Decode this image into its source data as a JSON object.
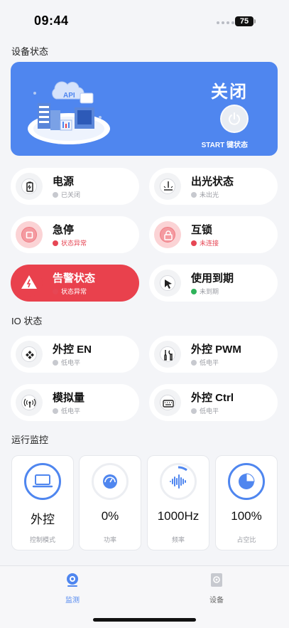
{
  "status_bar": {
    "time": "09:44",
    "battery": "75"
  },
  "sections": {
    "device": "设备状态",
    "io": "IO 状态",
    "monitor": "运行监控"
  },
  "hero": {
    "illustration_label": "API",
    "state": "关闭",
    "subtitle": "START 键状态"
  },
  "device_status": [
    {
      "title": "电源",
      "status": "已关闭",
      "kind": "info",
      "icon": "battery-icon"
    },
    {
      "title": "出光状态",
      "status": "未出光",
      "kind": "info",
      "icon": "laser-icon"
    },
    {
      "title": "急停",
      "status": "状态异常",
      "kind": "error",
      "icon": "stop-icon"
    },
    {
      "title": "互锁",
      "status": "未连接",
      "kind": "error",
      "icon": "lock-icon"
    },
    {
      "title": "告警状态",
      "status": "状态异常",
      "kind": "alarm",
      "icon": "warning-icon"
    },
    {
      "title": "使用到期",
      "status": "未到期",
      "kind": "ok",
      "icon": "cursor-icon"
    }
  ],
  "io_status": [
    {
      "title": "外控 EN",
      "status": "低电平",
      "icon": "gamepad-icon"
    },
    {
      "title": "外控 PWM",
      "status": "低电平",
      "icon": "tools-icon"
    },
    {
      "title": "模拟量",
      "status": "低电平",
      "icon": "antenna-icon"
    },
    {
      "title": "外控 Ctrl",
      "status": "低电平",
      "icon": "keyboard-icon"
    }
  ],
  "monitor": [
    {
      "value": "外控",
      "label": "控制模式",
      "icon": "laptop-icon"
    },
    {
      "value": "0%",
      "label": "功率",
      "icon": "gauge-icon"
    },
    {
      "value": "1000Hz",
      "label": "频率",
      "icon": "waveform-icon"
    },
    {
      "value": "100%",
      "label": "占空比",
      "icon": "pie-chart-icon"
    }
  ],
  "tabs": [
    {
      "label": "监测",
      "active": true,
      "icon": "monitor-camera-icon"
    },
    {
      "label": "设备",
      "active": false,
      "icon": "device-icon"
    }
  ],
  "colors": {
    "accent": "#4f86ef",
    "alarm": "#e9414d",
    "error": "#e64654",
    "ok": "#2fb35a"
  }
}
